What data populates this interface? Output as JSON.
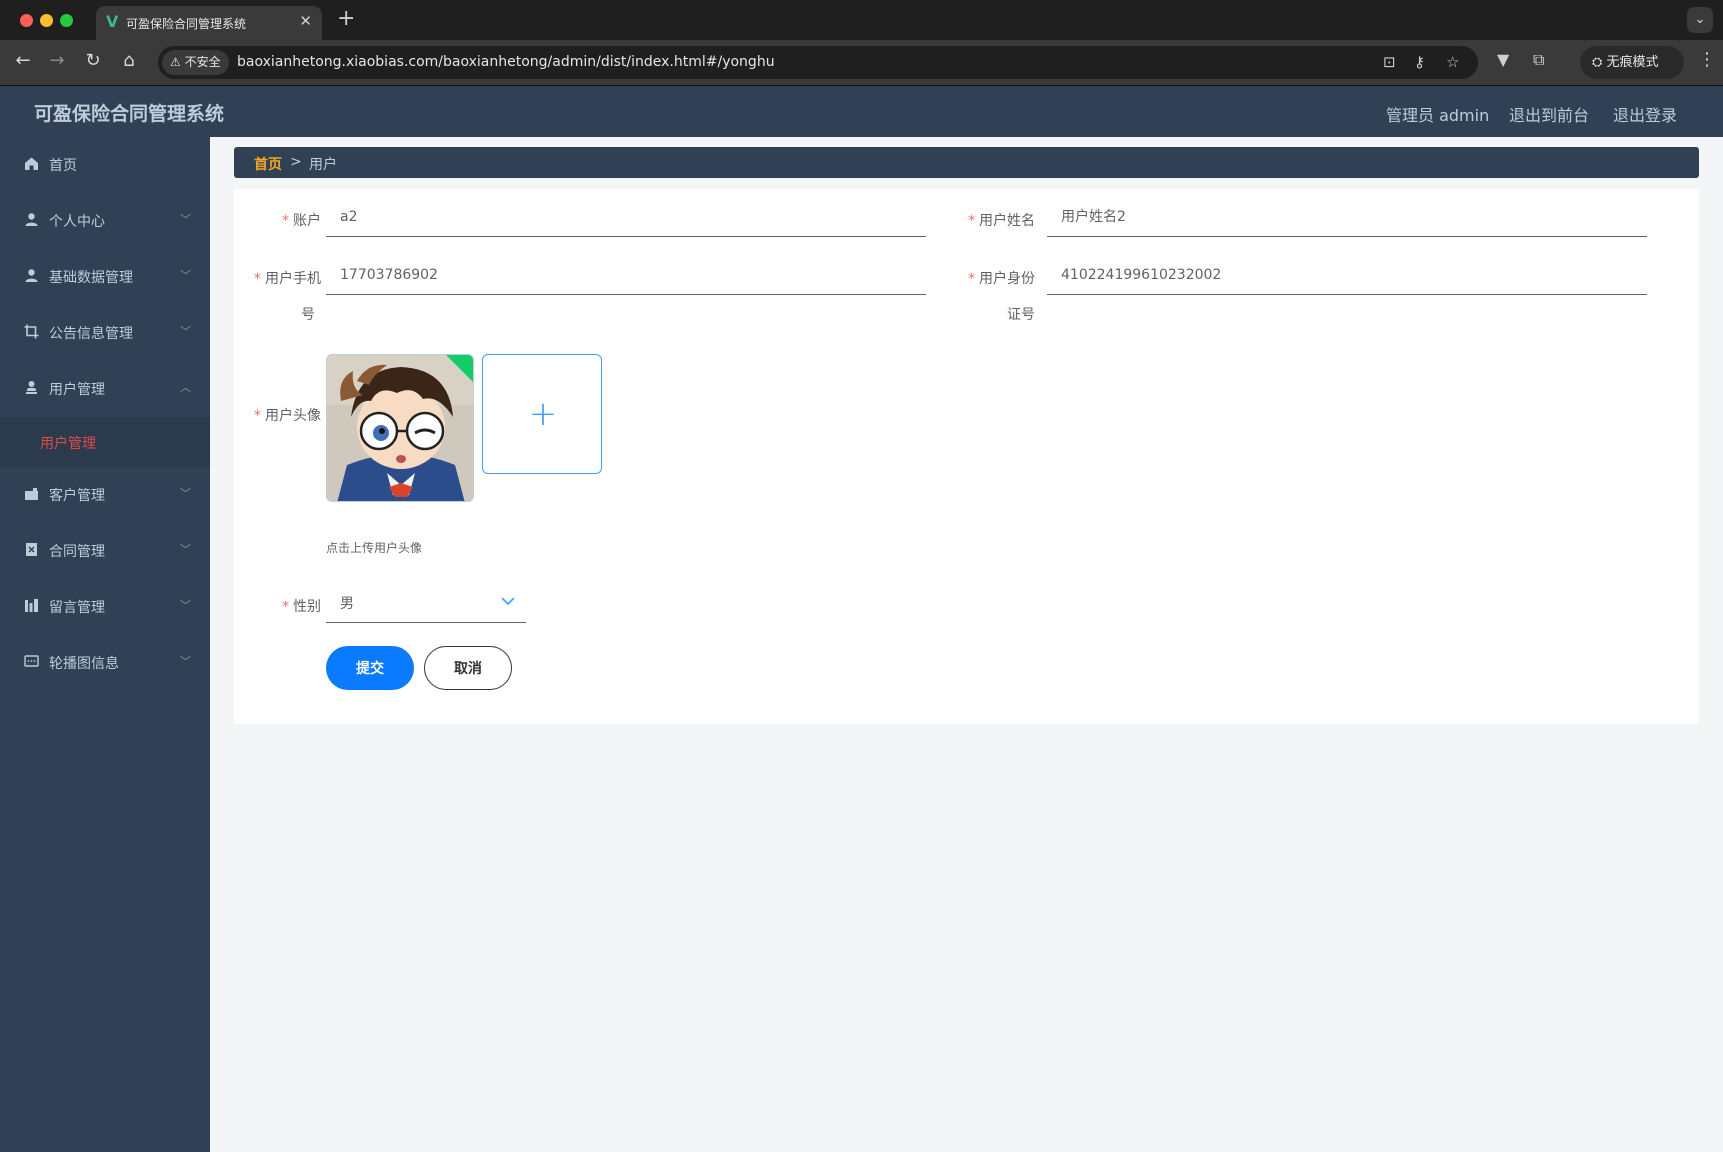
{
  "browser": {
    "tab_title": "可盈保险合同管理系统",
    "tab_logo": "V",
    "security_label": "不安全",
    "url": "baoxianhetong.xiaobias.com/baoxianhetong/admin/dist/index.html#/yonghu",
    "incognito_label": "无痕模式"
  },
  "header": {
    "title": "可盈保险合同管理系统",
    "user": "管理员 admin",
    "to_front": "退出到前台",
    "logout": "退出登录"
  },
  "sidebar": {
    "items": [
      {
        "label": "首页",
        "icon": "home-icon"
      },
      {
        "label": "个人中心",
        "icon": "user-icon"
      },
      {
        "label": "基础数据管理",
        "icon": "user-icon"
      },
      {
        "label": "公告信息管理",
        "icon": "crop-icon"
      },
      {
        "label": "用户管理",
        "icon": "user-icon"
      },
      {
        "label": "客户管理",
        "icon": "briefcase-icon"
      },
      {
        "label": "合同管理",
        "icon": "document-icon"
      },
      {
        "label": "留言管理",
        "icon": "chart-icon"
      },
      {
        "label": "轮播图信息",
        "icon": "message-icon"
      }
    ],
    "active_sub": "用户管理"
  },
  "breadcrumb": {
    "home": "首页",
    "separator": ">",
    "current": "用户"
  },
  "form": {
    "account_label": "账户",
    "account_value": "a2",
    "name_label": "用户姓名",
    "name_value": "用户姓名2",
    "phone_label_1": "用户手机",
    "phone_label_2": "号",
    "phone_value": "17703786902",
    "id_label_1": "用户身份",
    "id_label_2": "证号",
    "id_value": "410224199610232002",
    "avatar_label": "用户头像",
    "upload_tip": "点击上传用户头像",
    "gender_label": "性别",
    "gender_value": "男",
    "required_mark": "*",
    "submit": "提交",
    "cancel": "取消"
  },
  "colors": {
    "header_bg": "#304156",
    "active_menu": "#e04b4b",
    "breadcrumb_home": "#f5a623",
    "primary": "#0a7aff",
    "upload_border": "#409eff"
  }
}
